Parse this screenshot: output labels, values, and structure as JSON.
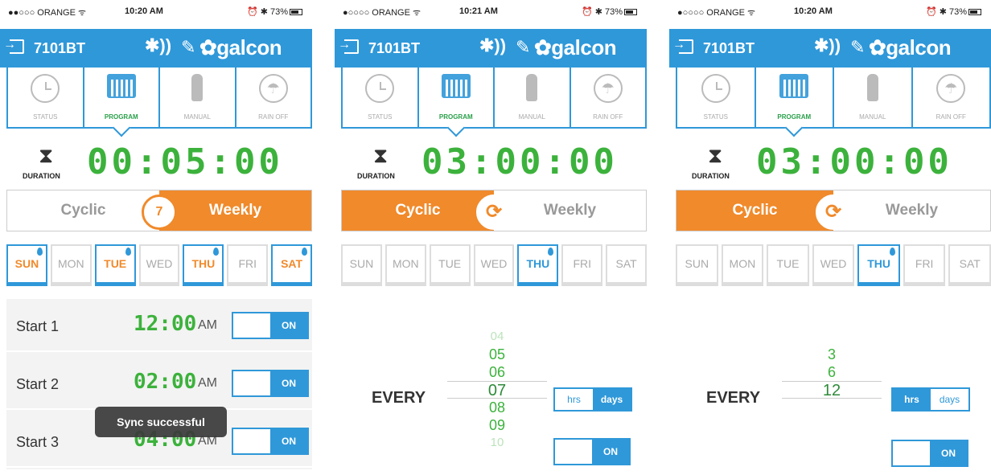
{
  "screens": [
    {
      "status": {
        "carrier": "●●○○○ ORANGE ᯤ",
        "time": "10:20 AM",
        "battery": "73%"
      },
      "header": {
        "device": "7101BT",
        "brand": "galcon"
      },
      "tabs": [
        "STATUS",
        "PROGRAM",
        "MANUAL",
        "RAIN OFF"
      ],
      "duration_label": "DURATION",
      "duration": "00:05:00",
      "mode": {
        "cyclic": "Cyclic",
        "weekly": "Weekly",
        "selected": "weekly",
        "center_icon": "calendar-7-icon"
      },
      "days": [
        "SUN",
        "MON",
        "TUE",
        "WED",
        "THU",
        "FRI",
        "SAT"
      ],
      "starts": [
        {
          "label": "Start 1",
          "time": "12:00",
          "ampm": "AM",
          "toggle": "ON"
        },
        {
          "label": "Start 2",
          "time": "02:00",
          "ampm": "AM",
          "toggle": "ON"
        },
        {
          "label": "Start 3",
          "time": "04:00",
          "ampm": "AM",
          "toggle": "ON"
        }
      ],
      "toast": "Sync successful"
    },
    {
      "status": {
        "carrier": "●○○○○ ORANGE ᯤ",
        "time": "10:21 AM",
        "battery": "73%"
      },
      "header": {
        "device": "7101BT",
        "brand": "galcon"
      },
      "tabs": [
        "STATUS",
        "PROGRAM",
        "MANUAL",
        "RAIN OFF"
      ],
      "duration_label": "DURATION",
      "duration": "03:00:00",
      "mode": {
        "cyclic": "Cyclic",
        "weekly": "Weekly",
        "selected": "cyclic",
        "center_icon": "refresh-icon"
      },
      "days": [
        "SUN",
        "MON",
        "TUE",
        "WED",
        "THU",
        "FRI",
        "SAT"
      ],
      "every_label": "EVERY",
      "picker": [
        "04",
        "05",
        "06",
        "07",
        "08",
        "09",
        "10"
      ],
      "units": {
        "hrs": "hrs",
        "days": "days",
        "selected": "days"
      },
      "toggle": "ON"
    },
    {
      "status": {
        "carrier": "●○○○○ ORANGE ᯤ",
        "time": "10:20 AM",
        "battery": "73%"
      },
      "header": {
        "device": "7101BT",
        "brand": "galcon"
      },
      "tabs": [
        "STATUS",
        "PROGRAM",
        "MANUAL",
        "RAIN OFF"
      ],
      "duration_label": "DURATION",
      "duration": "03:00:00",
      "mode": {
        "cyclic": "Cyclic",
        "weekly": "Weekly",
        "selected": "cyclic",
        "center_icon": "refresh-icon"
      },
      "days": [
        "SUN",
        "MON",
        "TUE",
        "WED",
        "THU",
        "FRI",
        "SAT"
      ],
      "every_label": "EVERY",
      "picker": [
        "3",
        "6",
        "12"
      ],
      "units": {
        "hrs": "hrs",
        "days": "days",
        "selected": "hrs"
      },
      "toggle": "ON"
    }
  ]
}
